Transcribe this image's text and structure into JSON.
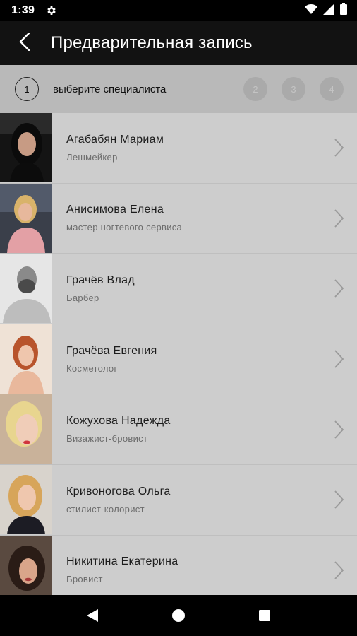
{
  "status_bar": {
    "time": "1:39",
    "icons": [
      "gear-icon",
      "wifi-icon",
      "signal-icon",
      "battery-icon"
    ]
  },
  "app_bar": {
    "title": "Предварительная запись",
    "back_icon": "back-arrow-icon"
  },
  "stepper": {
    "active_step": "1",
    "active_label": "выберите специалиста",
    "steps": [
      "2",
      "3",
      "4"
    ]
  },
  "specialists": [
    {
      "name": "Агабабян Мариам",
      "role": "Лешмейкер"
    },
    {
      "name": "Анисимова Елена",
      "role": "мастер ногтевого сервиса"
    },
    {
      "name": "Грачёв Влад",
      "role": "Барбер"
    },
    {
      "name": "Грачёва Евгения",
      "role": "Косметолог"
    },
    {
      "name": "Кожухова Надежда",
      "role": "Визажист-бровист"
    },
    {
      "name": "Кривоногова Ольга",
      "role": "стилист-колорист"
    },
    {
      "name": "Никитина Екатерина",
      "role": "Бровист"
    }
  ],
  "nav_bar": {
    "icons": [
      "back-triangle-icon",
      "home-circle-icon",
      "recents-square-icon"
    ]
  },
  "colors": {
    "status_bar": "#000000",
    "app_bar": "#121212",
    "stepper": "#b9b9b9",
    "list_bg": "#cdcdcd"
  }
}
